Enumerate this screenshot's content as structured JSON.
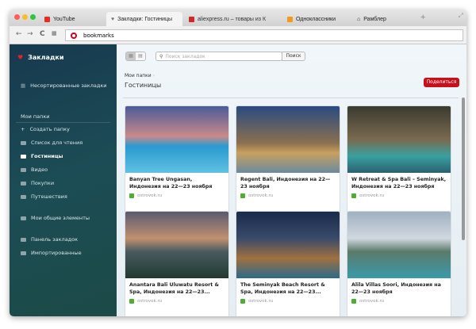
{
  "tabs": [
    {
      "label": "YouTube",
      "color": "#e52d27"
    },
    {
      "label": "Закладки: Гостиницы",
      "color": "#777"
    },
    {
      "label": "aliexpress.ru – товары из К",
      "color": "#d0262c"
    },
    {
      "label": "Одноклассники",
      "color": "#f39a1e"
    },
    {
      "label": "Рамблер",
      "color": "#333"
    }
  ],
  "address": "bookmarks",
  "sidebar": {
    "title": "Закладки",
    "unsorted": "Несортированные закладки",
    "my_folders": "Мои папки",
    "create": "Создать папку",
    "folders": [
      "Список для чтения",
      "Гостиницы",
      "Видео",
      "Покупки",
      "Путешествия"
    ],
    "shared": "Мои общие элементы",
    "bar": "Панель закладок",
    "imported": "Импортированные"
  },
  "main": {
    "search_placeholder": "Поиск закладок",
    "search_button": "Поиск",
    "breadcrumb": "Мои папки",
    "folder_title": "Гостиницы",
    "share": "Поделиться",
    "cards": [
      {
        "title": "Banyan Tree Ungasan, Индонезия на 22—23 ноября",
        "source": "ostrovok.ru"
      },
      {
        "title": "Regent Bali, Индонезия на 22—23 ноября",
        "source": "ostrovok.ru"
      },
      {
        "title": "W Retreat & Spa Bali – Seminyak, Индонезия на 22—23 ноября",
        "source": "ostrovok.ru"
      },
      {
        "title": "Anantara Bali Uluwatu Resort & Spa, Индонезия на 22—23...",
        "source": "ostrovok.ru"
      },
      {
        "title": "The Seminyak Beach Resort & Spa, Индонезия на 22—23...",
        "source": "ostrovok.ru"
      },
      {
        "title": "Alila Villas Soori, Индонезия на 22—23 ноября",
        "source": "ostrovok.ru"
      }
    ]
  }
}
